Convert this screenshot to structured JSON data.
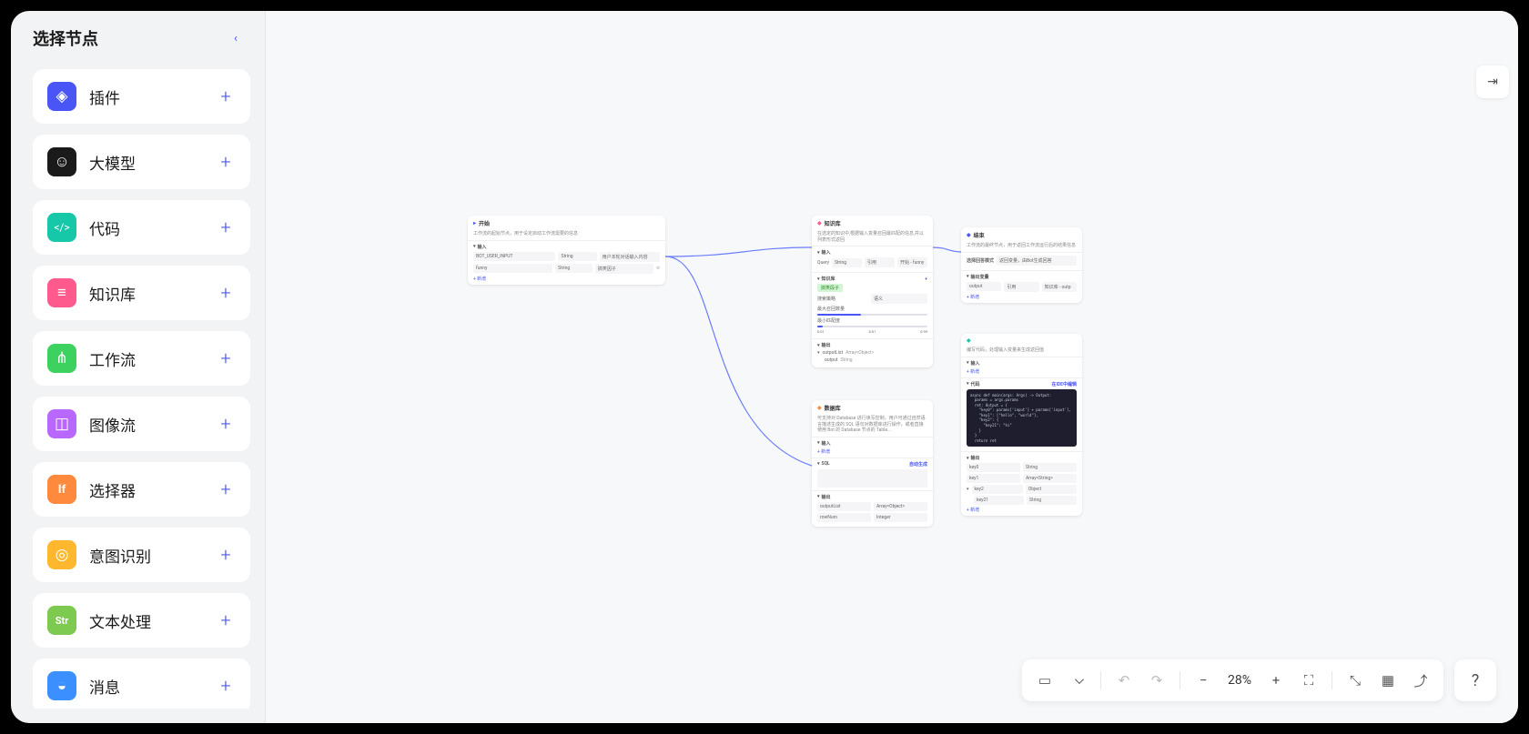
{
  "sidebar": {
    "title": "选择节点",
    "items": [
      {
        "label": "插件",
        "icon": "◈",
        "bg": "#4955f5"
      },
      {
        "label": "大模型",
        "icon": "☺",
        "bg": "#1a1a1a"
      },
      {
        "label": "代码",
        "icon": "</>",
        "bg": "#16c7a8"
      },
      {
        "label": "知识库",
        "icon": "≡",
        "bg": "#ff5a8e"
      },
      {
        "label": "工作流",
        "icon": "⋔",
        "bg": "#3dd15f"
      },
      {
        "label": "图像流",
        "icon": "◫",
        "bg": "#b968ff"
      },
      {
        "label": "选择器",
        "icon": "If",
        "bg": "#ff8a3d"
      },
      {
        "label": "意图识别",
        "icon": "◎",
        "bg": "#ffb82e"
      },
      {
        "label": "文本处理",
        "icon": "Str",
        "bg": "#7ec94f"
      },
      {
        "label": "消息",
        "icon": "◒",
        "bg": "#3b8fff"
      }
    ]
  },
  "toolbar": {
    "zoom": "28%"
  },
  "canvas": {
    "nodes": {
      "start": {
        "title": "开始",
        "desc": "工作流的起始节点，用于设定启动工作流需要的信息",
        "section_input": "输入",
        "rows": [
          {
            "name": "BOT_USER_INPUT",
            "type": "String",
            "desc": "用户本轮对话输入内容"
          },
          {
            "name": "funny",
            "type": "String",
            "desc": "搞笑因子"
          }
        ],
        "add": "+ 新增"
      },
      "knowledge": {
        "title": "知识库",
        "desc": "在选定的知识中,根据输入变量召回最匹配的信息,并以列表形式返回",
        "section_input": "输入",
        "query_label": "Query",
        "query_type": "String",
        "query_ref": "引用",
        "query_val": "开始 - funny",
        "section_kb": "知识库",
        "kb_tag": "搞笑段子",
        "search_label": "搜索策略",
        "search_val": "语义",
        "count_label": "最大召回数量",
        "min_label": "最小匹配度",
        "min_range": [
          "0.01",
          "0.01",
          "0.99"
        ],
        "section_output": "输出",
        "out_list": "outputList",
        "out_list_type": "Array<Object>",
        "out_item": "output",
        "out_item_type": "String"
      },
      "end": {
        "title": "结束",
        "desc": "工作流的最终节点，用于返回工作流运行后的结果信息",
        "mode_label": "选择回答模式",
        "mode_val": "返回变量，由Bot生成回答",
        "section_output": "输出变量",
        "out_name": "output",
        "out_type": "引用",
        "out_ref": "知识库 - outp",
        "add": "+ 新增"
      },
      "code": {
        "desc": "编写代码，处理输入变量来生成返回值",
        "section_input": "输入",
        "add": "+ 新增",
        "section_code": "代码",
        "edit_label": "在IDE中编辑",
        "code_body": "async def main(args: Args) -> Output:\n  params = args.params\n  ret: Output = {\n    \"key0\": params['input'] + params['input'],\n    \"key1\": [\"hello\", \"world\"],\n    \"key2\": {\n      \"key21\": \"hi\"\n    }\n  }\n  return ret",
        "section_output": "输出",
        "outs": [
          {
            "name": "key0",
            "type": "String"
          },
          {
            "name": "key1",
            "type": "Array<String>"
          },
          {
            "name": "key2",
            "type": "Object"
          },
          {
            "name": "key21",
            "type": "String",
            "indent": true
          }
        ]
      },
      "db": {
        "title": "数据库",
        "desc": "可支持对 Database 进行读写控制，用户可通过自然语言描述生成的 SQL 语句对数据库进行操作，或者直接使用 Bot 的 Database 节点的 Table...",
        "section_input": "输入",
        "add": "+ 新增",
        "section_sql": "SQL",
        "sql_gen": "自动生成",
        "section_output": "输出",
        "outs": [
          {
            "name": "outputList",
            "type": "Array<Object>"
          },
          {
            "name": "rowNum",
            "type": "Integer"
          }
        ]
      }
    }
  }
}
